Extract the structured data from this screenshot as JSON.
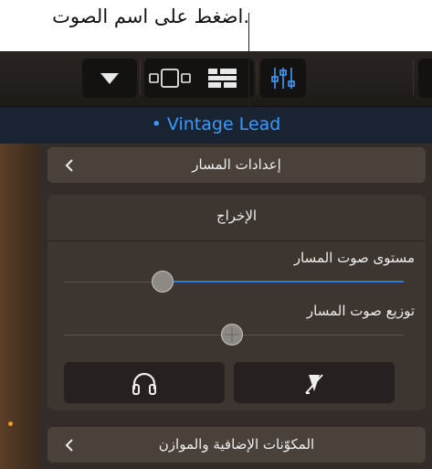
{
  "callout": {
    "text": "اضغط على اسم الصوت."
  },
  "patch_name": "• Vintage Lead",
  "panel": {
    "track_settings": "إعدادات المسار",
    "output_title": "الإخراج",
    "track_volume": {
      "label": "مستوى صوت المسار",
      "value": 0.29
    },
    "track_pan": {
      "label": "توزيع صوت المسار",
      "value": 0.5
    },
    "plugins_eq": "المكوّنات الإضافية والموازن"
  },
  "colors": {
    "accent": "#3a9bff",
    "background": "#332c28",
    "indicator": "#f39a1e"
  }
}
